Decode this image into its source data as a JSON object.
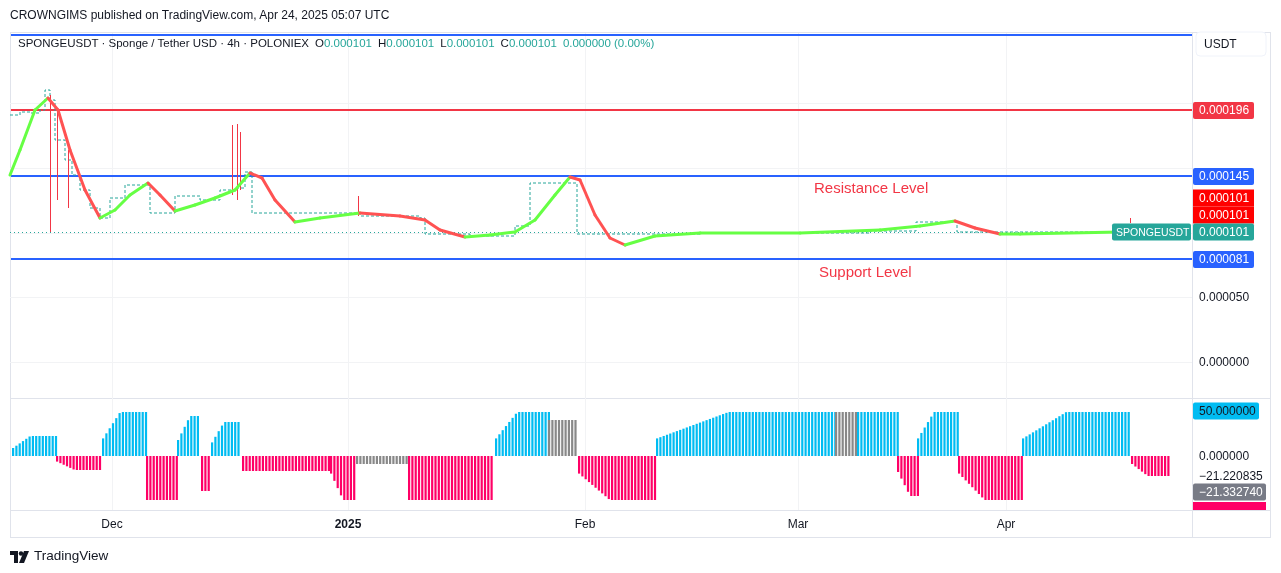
{
  "header": {
    "text": "CROWNGIMS published on TradingView.com, Apr 24, 2025 05:07 UTC"
  },
  "legend": {
    "symbol": "SPONGEUSDT · Sponge / Tether USD · 4h · POLONIEX",
    "values": [
      {
        "label": "O",
        "value": "0.000101"
      },
      {
        "label": "H",
        "value": "0.000101"
      },
      {
        "label": "L",
        "value": "0.000101"
      },
      {
        "label": "C",
        "value": "0.000101"
      }
    ],
    "change": "0.000000 (0.00%)"
  },
  "price_axis": {
    "currency": "USDT",
    "ticks": [
      "0.000050",
      "0.000000"
    ]
  },
  "levels": [
    {
      "color": "#2962ff"
    },
    {
      "price": "0.000196",
      "color": "#f23645"
    },
    {
      "price": "0.000145",
      "color": "#2962ff"
    },
    {
      "price": "0.000081",
      "color": "#2962ff"
    }
  ],
  "price_labels": [
    {
      "text": "0.000101",
      "color": "#ff0000"
    },
    {
      "text": "0.000101",
      "color": "#ff0000"
    },
    {
      "text": "0.000101",
      "color": "#26a69a",
      "tag": "SPONGEUSDT"
    }
  ],
  "annotations": [
    {
      "text": "Resistance Level"
    },
    {
      "text": "Support Level"
    }
  ],
  "oscillator_axis": [
    {
      "text": "50.000000",
      "kind": "badge",
      "color": "#00bcf2"
    },
    {
      "text": "0.000000",
      "kind": "plain"
    },
    {
      "text": "−21.220835",
      "kind": "plain"
    },
    {
      "text": "−21.332740",
      "kind": "badge",
      "color": "#787b86"
    }
  ],
  "time_axis": [
    {
      "label": "Dec",
      "bold": false
    },
    {
      "label": "2025",
      "bold": true
    },
    {
      "label": "Feb",
      "bold": false
    },
    {
      "label": "Mar",
      "bold": false
    },
    {
      "label": "Apr",
      "bold": false
    }
  ],
  "footer": {
    "brand": "TradingView"
  }
}
